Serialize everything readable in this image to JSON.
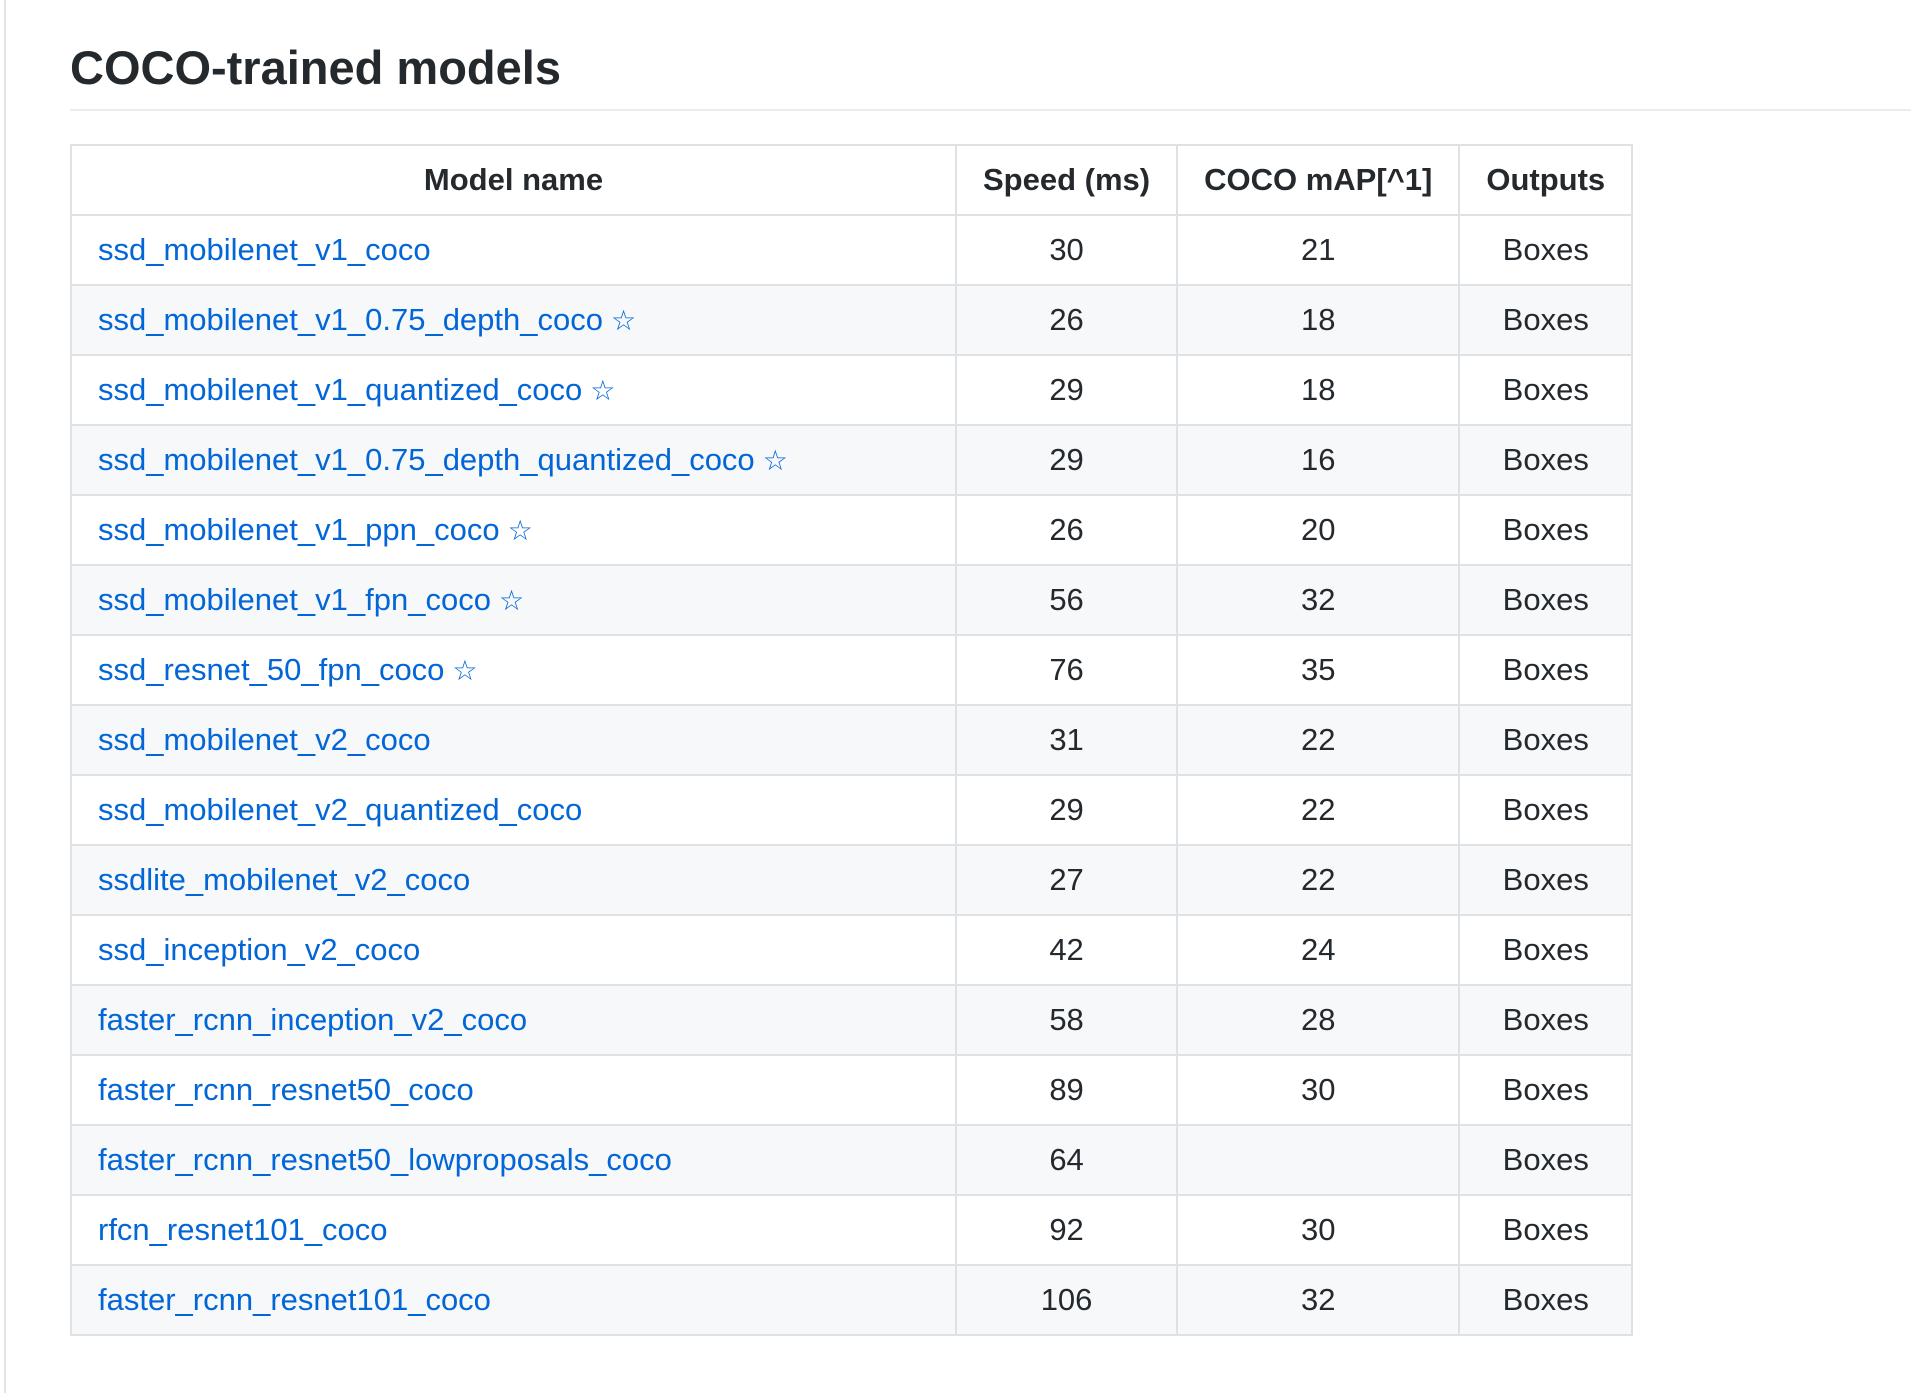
{
  "page": {
    "title": "COCO-trained models"
  },
  "table": {
    "headers": {
      "name": "Model name",
      "speed": "Speed (ms)",
      "map": "COCO mAP[^1]",
      "outputs": "Outputs"
    },
    "rows": [
      {
        "name": "ssd_mobilenet_v1_coco",
        "star": "",
        "speed": "30",
        "map": "21",
        "outputs": "Boxes"
      },
      {
        "name": "ssd_mobilenet_v1_0.75_depth_coco",
        "star": "☆",
        "speed": "26",
        "map": "18",
        "outputs": "Boxes"
      },
      {
        "name": "ssd_mobilenet_v1_quantized_coco",
        "star": "☆",
        "speed": "29",
        "map": "18",
        "outputs": "Boxes"
      },
      {
        "name": "ssd_mobilenet_v1_0.75_depth_quantized_coco",
        "star": "☆",
        "speed": "29",
        "map": "16",
        "outputs": "Boxes"
      },
      {
        "name": "ssd_mobilenet_v1_ppn_coco",
        "star": "☆",
        "speed": "26",
        "map": "20",
        "outputs": "Boxes"
      },
      {
        "name": "ssd_mobilenet_v1_fpn_coco",
        "star": "☆",
        "speed": "56",
        "map": "32",
        "outputs": "Boxes"
      },
      {
        "name": "ssd_resnet_50_fpn_coco",
        "star": "☆",
        "speed": "76",
        "map": "35",
        "outputs": "Boxes"
      },
      {
        "name": "ssd_mobilenet_v2_coco",
        "star": "",
        "speed": "31",
        "map": "22",
        "outputs": "Boxes"
      },
      {
        "name": "ssd_mobilenet_v2_quantized_coco",
        "star": "",
        "speed": "29",
        "map": "22",
        "outputs": "Boxes"
      },
      {
        "name": "ssdlite_mobilenet_v2_coco",
        "star": "",
        "speed": "27",
        "map": "22",
        "outputs": "Boxes"
      },
      {
        "name": "ssd_inception_v2_coco",
        "star": "",
        "speed": "42",
        "map": "24",
        "outputs": "Boxes"
      },
      {
        "name": "faster_rcnn_inception_v2_coco",
        "star": "",
        "speed": "58",
        "map": "28",
        "outputs": "Boxes"
      },
      {
        "name": "faster_rcnn_resnet50_coco",
        "star": "",
        "speed": "89",
        "map": "30",
        "outputs": "Boxes"
      },
      {
        "name": "faster_rcnn_resnet50_lowproposals_coco",
        "star": "",
        "speed": "64",
        "map": "",
        "outputs": "Boxes"
      },
      {
        "name": "rfcn_resnet101_coco",
        "star": "",
        "speed": "92",
        "map": "30",
        "outputs": "Boxes"
      },
      {
        "name": "faster_rcnn_resnet101_coco",
        "star": "",
        "speed": "106",
        "map": "32",
        "outputs": "Boxes"
      }
    ]
  },
  "colors": {
    "link": "#0366d6",
    "text": "#24292e",
    "border": "#dfe2e5",
    "row_alt": "#f6f8fa"
  }
}
